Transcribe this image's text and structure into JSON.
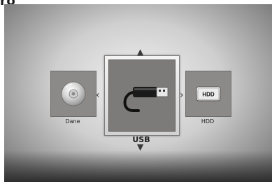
{
  "header": {
    "fragment": "ro"
  },
  "menu": {
    "items": [
      {
        "label": "Dane",
        "icon": "disc-icon"
      },
      {
        "label": "USB",
        "icon": "usb-icon"
      },
      {
        "label": "HDD",
        "icon": "hdd-icon",
        "icon_text": "HDD"
      }
    ],
    "selected_index": 1
  },
  "colors": {
    "tile": "#8c8a88",
    "frame": "#d2d2d2",
    "background": "#bdbdbd"
  }
}
